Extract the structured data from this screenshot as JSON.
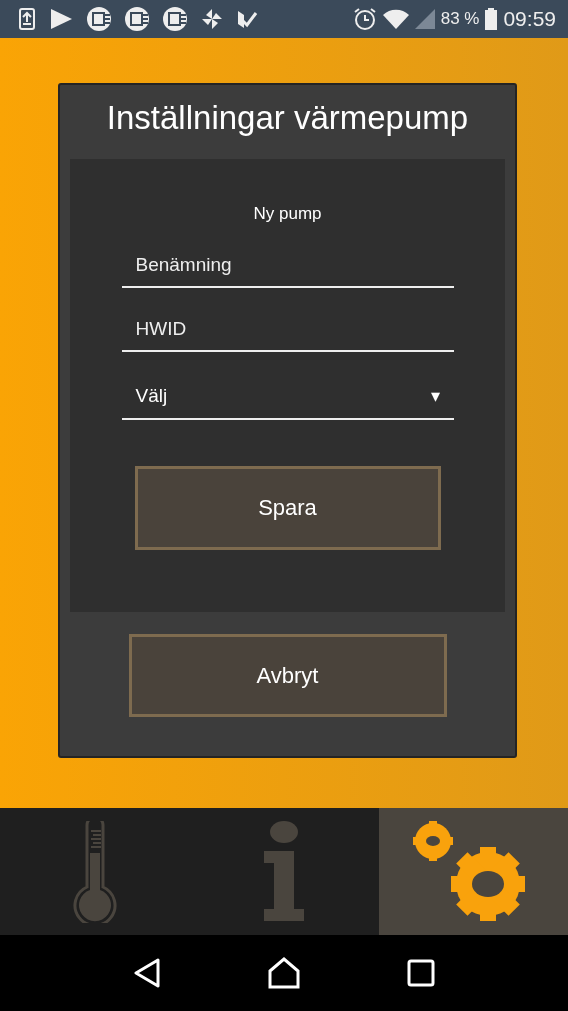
{
  "status_bar": {
    "battery": "83 %",
    "time": "09:59"
  },
  "dialog": {
    "title": "Inställningar värmepump",
    "form": {
      "heading": "Ny pump",
      "fields": [
        {
          "kind": "text",
          "placeholder": "Benämning"
        },
        {
          "kind": "text",
          "placeholder": "HWID"
        },
        {
          "kind": "select",
          "value": "Välj",
          "caret": "▾"
        }
      ],
      "save": "Spara"
    },
    "cancel": "Avbryt"
  },
  "tabs": [
    {
      "kind": "temperature",
      "selected": false
    },
    {
      "kind": "info",
      "selected": false
    },
    {
      "kind": "settings",
      "selected": true
    }
  ]
}
